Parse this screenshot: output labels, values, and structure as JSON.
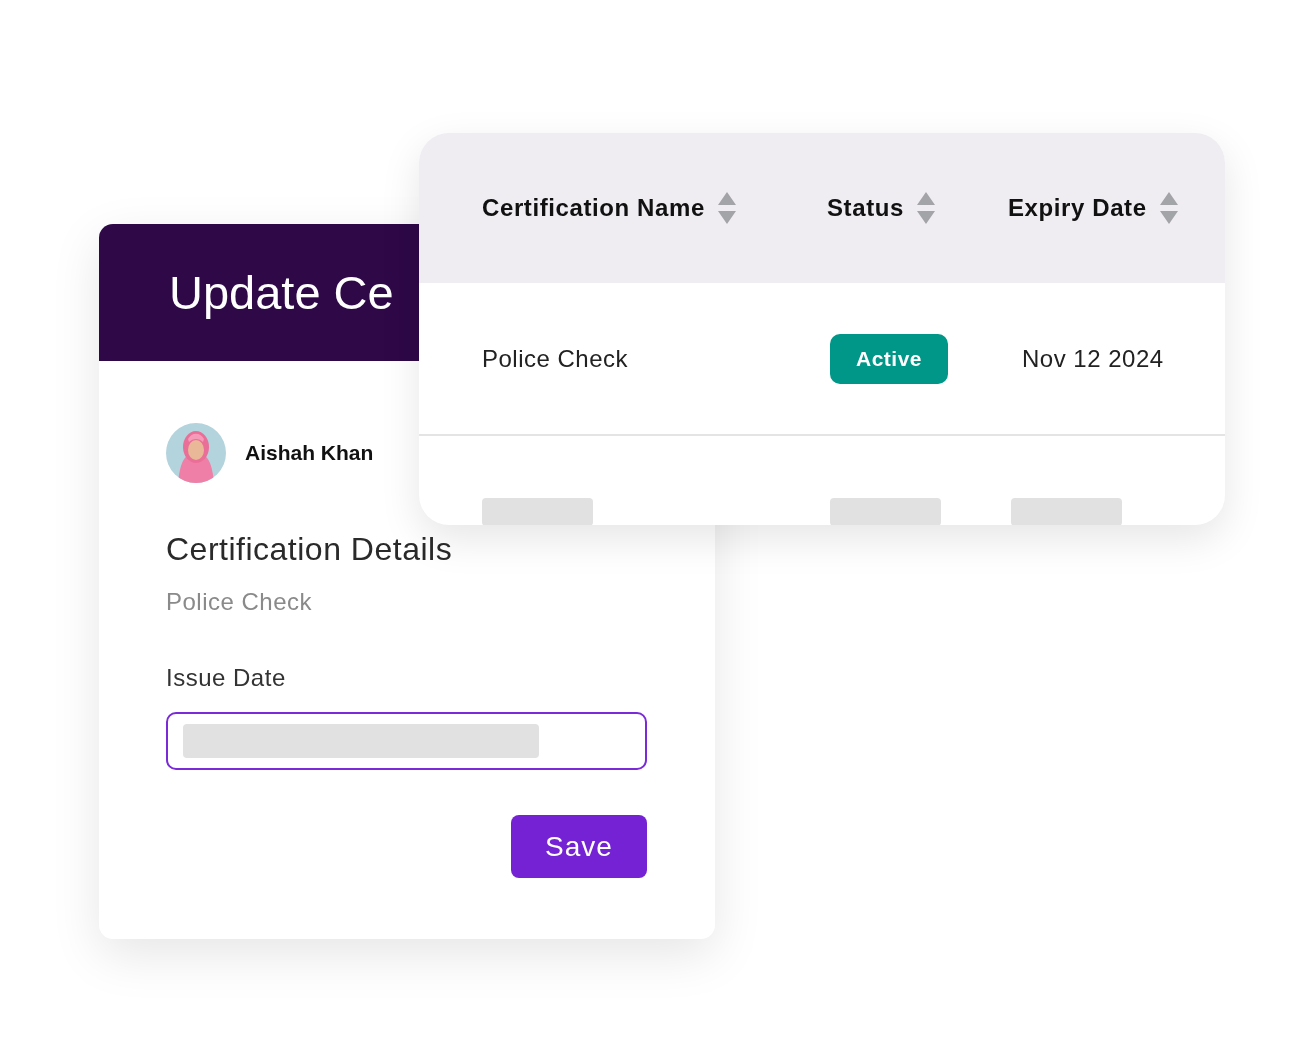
{
  "form": {
    "title": "Update Ce",
    "user": {
      "name": "Aishah Khan"
    },
    "section_title": "Certification Details",
    "certification": "Police Check",
    "fields": [
      {
        "label": "Issue Date"
      }
    ],
    "button": "Save"
  },
  "table": {
    "columns": [
      "Certification Name",
      "Status",
      "Expiry Date"
    ],
    "rows": [
      {
        "kind": "data",
        "name": "Police Check",
        "status": "Active",
        "expiry": "Nov 12 2024"
      },
      {
        "kind": "skeleton"
      }
    ]
  }
}
